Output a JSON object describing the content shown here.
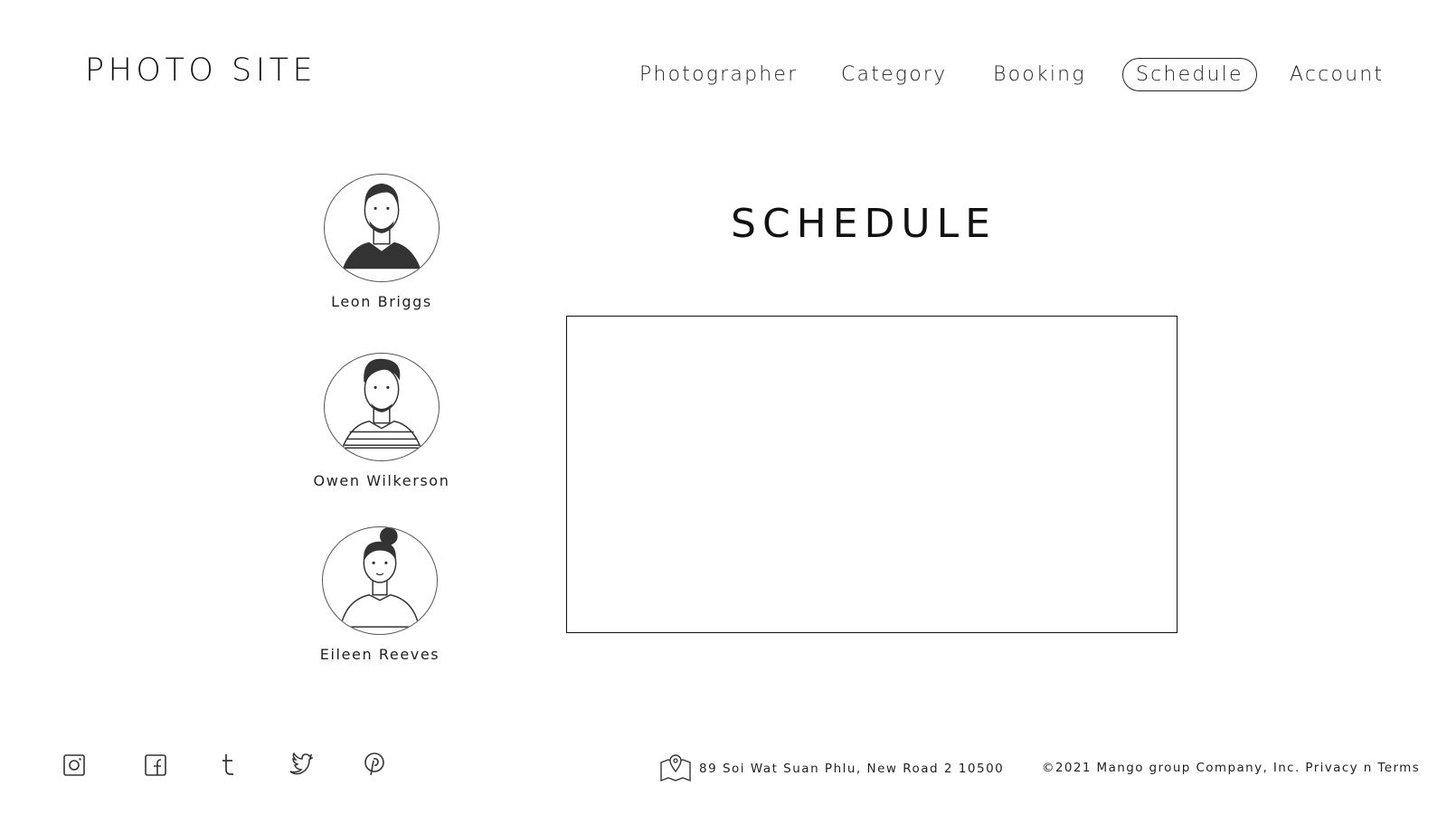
{
  "site": {
    "logo": "PHOTO SITE"
  },
  "nav": {
    "items": [
      {
        "label": "Photographer",
        "active": false
      },
      {
        "label": "Category",
        "active": false
      },
      {
        "label": "Booking",
        "active": false
      },
      {
        "label": "Schedule",
        "active": true
      },
      {
        "label": "Account",
        "active": false
      }
    ]
  },
  "main": {
    "title": "SCHEDULE"
  },
  "photographers": [
    {
      "name": "Leon Briggs",
      "icon": "avatar-man-beard-icon"
    },
    {
      "name": "Owen Wilkerson",
      "icon": "avatar-man-striped-shirt-icon"
    },
    {
      "name": "Eileen Reeves",
      "icon": "avatar-woman-bun-icon"
    }
  ],
  "footer": {
    "social": [
      "instagram-icon",
      "facebook-icon",
      "tumblr-icon",
      "twitter-icon",
      "pinterest-icon"
    ],
    "address": "89 Soi Wat Suan Phlu, New Road 2 10500",
    "copyright": "©2021 Mango group Company, Inc. Privacy n Terms"
  }
}
